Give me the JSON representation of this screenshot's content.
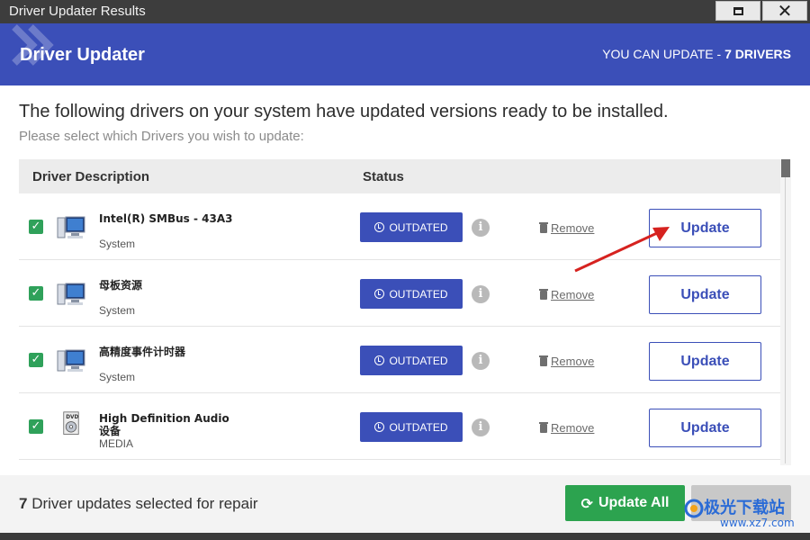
{
  "window": {
    "title": "Driver Updater Results",
    "maximize_icon": "maximize-icon",
    "close_icon": "close-icon",
    "close_glyph": "✕"
  },
  "header": {
    "app_title": "Driver Updater",
    "count_prefix": "YOU CAN UPDATE - ",
    "count_value": "7 DRIVERS",
    "color": "#3b4fb8"
  },
  "main": {
    "headline": "The following drivers on your system have updated versions ready to be installed.",
    "subline": "Please select which Drivers you wish to update:"
  },
  "table": {
    "columns": [
      "Driver Description",
      "Status"
    ],
    "rows": [
      {
        "checked": true,
        "icon": "computer-icon",
        "name": "Intel(R) SMBus - 43A3",
        "category": "System",
        "status": "OUTDATED",
        "remove_label": "Remove",
        "update_label": "Update"
      },
      {
        "checked": true,
        "icon": "computer-icon",
        "name": "母板资源",
        "category": "System",
        "status": "OUTDATED",
        "remove_label": "Remove",
        "update_label": "Update"
      },
      {
        "checked": true,
        "icon": "computer-icon",
        "name": "高精度事件计时器",
        "category": "System",
        "status": "OUTDATED",
        "remove_label": "Remove",
        "update_label": "Update"
      },
      {
        "checked": true,
        "icon": "dvd-drive-icon",
        "name": "High Definition Audio 设备",
        "category": "MEDIA",
        "status": "OUTDATED",
        "remove_label": "Remove",
        "update_label": "Update"
      }
    ],
    "check_glyph": "✓",
    "info_glyph": "i"
  },
  "footer": {
    "selected_count": "7",
    "selected_text": " Driver updates selected for repair",
    "update_all_label": "Update All",
    "update_all_icon": "sync-icon",
    "sync_glyph": "⟳",
    "update_all_color": "#2ca34f"
  },
  "watermark": {
    "text": "极光下载站",
    "url": "www.xz7.com"
  }
}
